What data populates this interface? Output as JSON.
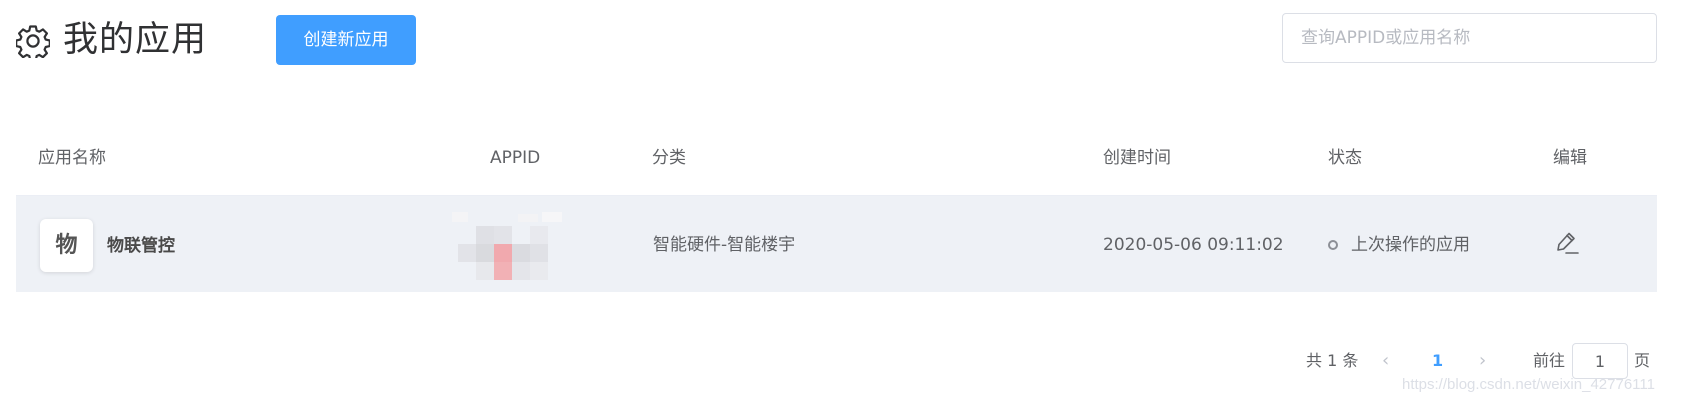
{
  "header": {
    "title": "我的应用",
    "create_button_label": "创建新应用",
    "search_placeholder": "查询APPID或应用名称",
    "search_value": ""
  },
  "table": {
    "columns": [
      "应用名称",
      "APPID",
      "分类",
      "创建时间",
      "状态",
      "编辑"
    ],
    "rows": [
      {
        "icon_char": "物",
        "name": "物联管控",
        "appid": "",
        "category": "智能硬件-智能楼宇",
        "created_at": "2020-05-06 09:11:02",
        "status": "上次操作的应用"
      }
    ]
  },
  "pagination": {
    "total_text": "共 1 条",
    "current_page": "1",
    "goto_prefix": "前往",
    "goto_value": "1",
    "goto_suffix": "页"
  },
  "watermark": "https://blog.csdn.net/weixin_42776111",
  "colors": {
    "primary": "#409eff",
    "row_background": "#eef1f6",
    "text": "#606266"
  },
  "icons": [
    "gear-icon",
    "edit-icon",
    "chevron-left-icon",
    "chevron-right-icon",
    "status-dot-icon"
  ]
}
